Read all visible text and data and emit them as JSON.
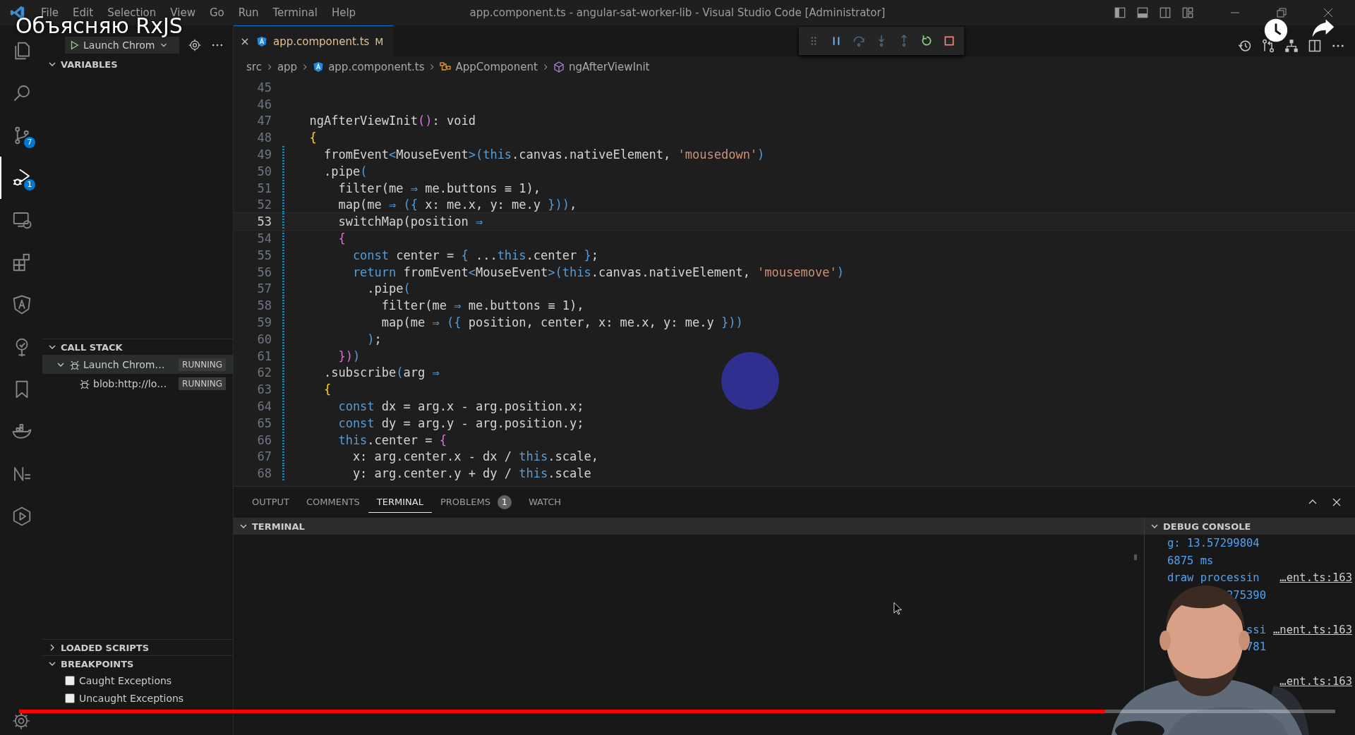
{
  "video": {
    "title": "Объясняю RxJS",
    "progress": {
      "level": 0.825
    }
  },
  "window": {
    "title": "app.component.ts - angular-sat-worker-lib - Visual Studio Code [Administrator]",
    "menu": [
      "File",
      "Edit",
      "Selection",
      "View",
      "Go",
      "Run",
      "Terminal",
      "Help"
    ]
  },
  "activity_bar": [
    {
      "selected": false
    },
    {
      "selected": false
    },
    {
      "selected": false,
      "badge": "7"
    },
    {
      "selected": true,
      "badge": "1"
    },
    {
      "selected": false
    },
    {
      "selected": false
    },
    {
      "selected": false
    },
    {
      "selected": false
    },
    {
      "selected": false
    },
    {
      "selected": false
    },
    {
      "selected": false
    },
    {
      "selected": false
    }
  ],
  "sidebar": {
    "launch_config": "Launch Chrom",
    "variables": {
      "title": "VARIABLES",
      "expanded": true
    },
    "call_stack": {
      "title": "CALL STACK",
      "expanded": true,
      "rows": [
        {
          "label": "Launch Chrom…",
          "status": "RUNNING",
          "selected": true,
          "expanded": true,
          "children": [
            {
              "label": "blob:http://lo…",
              "status": "RUNNING",
              "selected": false
            }
          ]
        }
      ]
    },
    "loaded_scripts": {
      "title": "LOADED SCRIPTS",
      "expanded": false
    },
    "breakpoints": {
      "title": "BREAKPOINTS",
      "expanded": true,
      "items": [
        {
          "label": "Caught Exceptions",
          "checked": false
        },
        {
          "label": "Uncaught Exceptions",
          "checked": false
        }
      ]
    }
  },
  "editor": {
    "tab": {
      "label": "app.component.ts",
      "status": "M"
    },
    "breadcrumb": [
      {
        "label": "src",
        "kind": "folder"
      },
      {
        "label": "app",
        "kind": "folder"
      },
      {
        "label": "app.component.ts",
        "kind": "file"
      },
      {
        "label": "AppComponent",
        "kind": "class"
      },
      {
        "label": "ngAfterViewInit",
        "kind": "method"
      }
    ],
    "lines": [
      {
        "n": "45",
        "changed": false,
        "current": false
      },
      {
        "n": "46",
        "changed": false,
        "current": false
      },
      {
        "n": "47",
        "changed": false,
        "current": false,
        "tokens": [
          {
            "text": "  ngAfterViewInit",
            "kind": "plain"
          },
          {
            "text": "()",
            "kind": "bracket2"
          },
          {
            "text": ": void",
            "kind": "plain"
          }
        ]
      },
      {
        "n": "48",
        "changed": false,
        "current": false,
        "tokens": [
          {
            "text": "  {",
            "kind": "bracket1"
          }
        ]
      },
      {
        "n": "49",
        "changed": true,
        "current": false,
        "tokens": [
          {
            "text": "    fromEvent",
            "kind": "plain"
          },
          {
            "text": "<",
            "kind": "keyword"
          },
          {
            "text": "MouseEvent",
            "kind": "plain"
          },
          {
            "text": ">(",
            "kind": "keyword"
          },
          {
            "text": "this",
            "kind": "keyword"
          },
          {
            "text": ".canvas.nativeElement, ",
            "kind": "plain"
          },
          {
            "text": "'mousedown'",
            "kind": "string"
          },
          {
            "text": ")",
            "kind": "keyword"
          }
        ]
      },
      {
        "n": "50",
        "changed": true,
        "current": false,
        "tokens": [
          {
            "text": "    .pipe",
            "kind": "plain"
          },
          {
            "text": "(",
            "kind": "keyword"
          }
        ]
      },
      {
        "n": "51",
        "changed": true,
        "current": false,
        "tokens": [
          {
            "text": "      filter(me ",
            "kind": "plain"
          },
          {
            "text": "⇒",
            "kind": "keyword"
          },
          {
            "text": " me.buttons ≡ 1),",
            "kind": "plain"
          }
        ]
      },
      {
        "n": "52",
        "changed": true,
        "current": false,
        "tokens": [
          {
            "text": "      map(me ",
            "kind": "plain"
          },
          {
            "text": "⇒",
            "kind": "keyword"
          },
          {
            "text": " ({",
            "kind": "keyword"
          },
          {
            "text": " x: me.x, y: me.y ",
            "kind": "plain"
          },
          {
            "text": "}))",
            "kind": "keyword"
          },
          {
            "text": ",",
            "kind": "plain"
          }
        ]
      },
      {
        "n": "53",
        "changed": true,
        "current": true,
        "tokens": [
          {
            "text": "      switchMap(position ",
            "kind": "plain"
          },
          {
            "text": "⇒",
            "kind": "keyword"
          }
        ]
      },
      {
        "n": "54",
        "changed": true,
        "current": false,
        "tokens": [
          {
            "text": "      {",
            "kind": "bracket2"
          }
        ]
      },
      {
        "n": "55",
        "changed": true,
        "current": false,
        "tokens": [
          {
            "text": "        const",
            "kind": "keyword"
          },
          {
            "text": " center = ",
            "kind": "plain"
          },
          {
            "text": "{",
            "kind": "keyword"
          },
          {
            "text": " ...",
            "kind": "plain"
          },
          {
            "text": "this",
            "kind": "keyword"
          },
          {
            "text": ".center ",
            "kind": "plain"
          },
          {
            "text": "}",
            "kind": "keyword"
          },
          {
            "text": ";",
            "kind": "plain"
          }
        ]
      },
      {
        "n": "56",
        "changed": true,
        "current": false,
        "tokens": [
          {
            "text": "        return",
            "kind": "keyword"
          },
          {
            "text": " fromEvent",
            "kind": "plain"
          },
          {
            "text": "<",
            "kind": "keyword"
          },
          {
            "text": "MouseEvent",
            "kind": "plain"
          },
          {
            "text": ">(",
            "kind": "keyword"
          },
          {
            "text": "this",
            "kind": "keyword"
          },
          {
            "text": ".canvas.nativeElement, ",
            "kind": "plain"
          },
          {
            "text": "'mousemove'",
            "kind": "string"
          },
          {
            "text": ")",
            "kind": "keyword"
          }
        ]
      },
      {
        "n": "57",
        "changed": true,
        "current": false,
        "tokens": [
          {
            "text": "          .pipe",
            "kind": "plain"
          },
          {
            "text": "(",
            "kind": "keyword"
          }
        ]
      },
      {
        "n": "58",
        "changed": true,
        "current": false,
        "tokens": [
          {
            "text": "            filter(me ",
            "kind": "plain"
          },
          {
            "text": "⇒",
            "kind": "keyword"
          },
          {
            "text": " me.buttons ≡ 1),",
            "kind": "plain"
          }
        ]
      },
      {
        "n": "59",
        "changed": true,
        "current": false,
        "tokens": [
          {
            "text": "            map(me ",
            "kind": "plain"
          },
          {
            "text": "⇒",
            "kind": "keyword"
          },
          {
            "text": " ({",
            "kind": "keyword"
          },
          {
            "text": " position, center, x: me.x, y: me.y ",
            "kind": "plain"
          },
          {
            "text": "}))",
            "kind": "keyword"
          }
        ]
      },
      {
        "n": "60",
        "changed": true,
        "current": false,
        "tokens": [
          {
            "text": "          )",
            "kind": "keyword"
          },
          {
            "text": ";",
            "kind": "plain"
          }
        ]
      },
      {
        "n": "61",
        "changed": true,
        "current": false,
        "tokens": [
          {
            "text": "      })",
            "kind": "bracket2"
          },
          {
            "text": ")",
            "kind": "keyword"
          }
        ]
      },
      {
        "n": "62",
        "changed": true,
        "current": false,
        "tokens": [
          {
            "text": "    .subscribe",
            "kind": "plain"
          },
          {
            "text": "(",
            "kind": "keyword"
          },
          {
            "text": "arg ",
            "kind": "plain"
          },
          {
            "text": "⇒",
            "kind": "keyword"
          }
        ]
      },
      {
        "n": "63",
        "changed": true,
        "current": false,
        "tokens": [
          {
            "text": "    {",
            "kind": "bracket1"
          }
        ]
      },
      {
        "n": "64",
        "changed": true,
        "current": false,
        "tokens": [
          {
            "text": "      const",
            "kind": "keyword"
          },
          {
            "text": " dx = arg.x - arg.position.x;",
            "kind": "plain"
          }
        ]
      },
      {
        "n": "65",
        "changed": true,
        "current": false,
        "tokens": [
          {
            "text": "      const",
            "kind": "keyword"
          },
          {
            "text": " dy = arg.y - arg.position.y;",
            "kind": "plain"
          }
        ]
      },
      {
        "n": "66",
        "changed": true,
        "current": false,
        "tokens": [
          {
            "text": "      this",
            "kind": "keyword"
          },
          {
            "text": ".center = ",
            "kind": "plain"
          },
          {
            "text": "{",
            "kind": "bracket2"
          }
        ]
      },
      {
        "n": "67",
        "changed": true,
        "current": false,
        "tokens": [
          {
            "text": "        x: arg.center.x - dx / ",
            "kind": "plain"
          },
          {
            "text": "this",
            "kind": "keyword"
          },
          {
            "text": ".scale,",
            "kind": "plain"
          }
        ]
      },
      {
        "n": "68",
        "changed": true,
        "current": false,
        "tokens": [
          {
            "text": "        y: arg.center.y + dy / ",
            "kind": "plain"
          },
          {
            "text": "this",
            "kind": "keyword"
          },
          {
            "text": ".scale",
            "kind": "plain"
          }
        ]
      }
    ]
  },
  "panel": {
    "tabs": [
      {
        "label": "OUTPUT",
        "selected": false
      },
      {
        "label": "COMMENTS",
        "selected": false
      },
      {
        "label": "TERMINAL",
        "selected": true
      },
      {
        "label": "PROBLEMS",
        "selected": false,
        "badge": "1"
      },
      {
        "label": "WATCH",
        "selected": false
      }
    ],
    "terminal": {
      "title": "TERMINAL",
      "expanded": true
    },
    "debug_console": {
      "title": "DEBUG CONSOLE",
      "expanded": true,
      "rows": [
        {
          "kind": "full",
          "value": "g: 13.57299804"
        },
        {
          "kind": "full",
          "value": "6875 ms"
        },
        {
          "kind": "full",
          "value": "draw processin",
          "source": "…ent.ts:163"
        },
        {
          "kind": "partial",
          "value": "275390"
        },
        {
          "kind": "blank"
        },
        {
          "kind": "partial",
          "value": "ssi",
          "source": "…nent.ts:163"
        },
        {
          "kind": "partial",
          "value": "781"
        },
        {
          "kind": "blank"
        },
        {
          "kind": "blank",
          "source": "…ent.ts:163"
        }
      ]
    }
  }
}
